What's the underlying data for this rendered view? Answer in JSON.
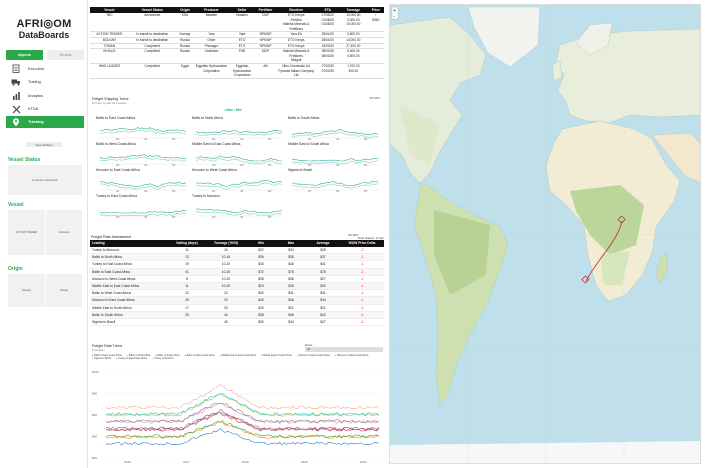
{
  "brand": {
    "name_line1": "AFRI◎OM",
    "name_line2": "DataBoards"
  },
  "tabs": {
    "active": "Imports",
    "inactive": "Exports"
  },
  "menu": [
    {
      "label": "Executive",
      "icon": "clipboard-icon"
    },
    {
      "label": "Trading",
      "icon": "truck-icon"
    },
    {
      "label": "Analytics",
      "icon": "bar-chart-icon"
    },
    {
      "label": "KTDA",
      "icon": "tools-icon"
    },
    {
      "label": "Tracking",
      "icon": "pin-icon"
    }
  ],
  "clear_filters": "Clear all filters",
  "vessel_status": {
    "title": "Vessel Status",
    "card": "in transit to destination"
  },
  "vessel": {
    "title": "Vessel",
    "cards": [
      "ACTION TRADER",
      "Unknown"
    ]
  },
  "origin": {
    "title": "Origin",
    "cards": [
      "Norway",
      "Russia"
    ]
  },
  "vessels_table": {
    "headers": [
      "Vessel",
      "Vessel Status",
      "Origin",
      "Producer",
      "Seller",
      "Fertilizer",
      "Receiver",
      "ETA",
      "Tonnage",
      "Price"
    ],
    "rows": [
      [
        "TBC",
        "Announced",
        "KSA",
        "Maaden",
        "Maaden",
        "DAP",
        "ETG Kenya / Fertiliza / Mabiha Minerals & Fertilizers",
        "07/08/20 / 01/08/20 / 01/08/20",
        "10,000.00 / 3,000.00 / 10,000.00",
        "/ / $360"
      ],
      [
        "ACTION TRADER",
        "In transit to destination",
        "Norway",
        "Yara",
        "Yara",
        "NPK/NP",
        "Yara EA",
        "28/04/20",
        "9,800.00",
        ""
      ],
      [
        "BOLKAR",
        "In transit to destination",
        "Russia",
        "Other",
        "ETG",
        "NPK/NP",
        "ETG Kenya",
        "28/04/20",
        "14,000.00",
        ""
      ],
      [
        "TOMAN",
        "Completed",
        "Russia",
        "Phosagro",
        "ETG",
        "NPK/NP",
        "ETG Kenya",
        "15/03/20",
        "27,400.00",
        ""
      ],
      [
        "IKHALIS",
        "Completed",
        "Russia",
        "Uralchem",
        "FSB",
        "MOP",
        "Mabiha Minerals & Fertilizers / Midgulf",
        "08/03/20 / 08/03/20",
        "9,400.00 / 4,500.00",
        ""
      ],
      [
        "HMO LEADER",
        "Completed",
        "Egypt",
        "Egyptian Hydrocarbon Corporation",
        "Egyptian Hydrocarbon Corporation",
        "AN",
        "Nitro Chemicals Ltd / Pyramid Italian Company Ltd",
        "07/03/20 / 07/03/20",
        "1,970.00 / 300.00",
        ""
      ]
    ]
  },
  "shipping_trend": {
    "title": "Freight Shipping Trend",
    "subtitle": "by Freq / by past from location",
    "legend": "• Max  • Min",
    "badge": "ZIP EDIT",
    "panels": [
      "Baltic to East Coast Africa",
      "Baltic to North Africa",
      "Baltic to South Africa",
      "Baltic to West Coast Africa",
      "Middle East to East Coast Africa",
      "Middle East to South Africa",
      "Morocco to East Coast Africa",
      "Morocco to West Coast Africa",
      "Nigeria to Brazil",
      "Turkey to East Coast Africa",
      "Turkey to Morocco"
    ],
    "ticks": [
      "20",
      "40",
      "60"
    ]
  },
  "rate_assessment": {
    "title": "Freight Rate Assessment",
    "badge": "ZIP EDIT",
    "timestamp": "Time Stamp: 17 Apr 20",
    "headers": [
      "Leading",
      "Sailing (days)",
      "Tonnage ('000t)",
      "Min",
      "Max",
      "Average",
      "WOW Price Delta"
    ],
    "rows": [
      [
        "Turkey to Morocco",
        "11",
        "10",
        "$22",
        "$34",
        "$28",
        "-2"
      ],
      [
        "Baltic to North Africa",
        "13",
        "10-16",
        "$36",
        "$38",
        "$37",
        "-1"
      ],
      [
        "Turkey to East Coast Africa",
        "19",
        "10-20",
        "$33",
        "$48",
        "$41",
        "-1"
      ],
      [
        "Baltic to East Coast Africa",
        "41",
        "10-20",
        "$72",
        "$78",
        "$75",
        "-2"
      ],
      [
        "Morocco to West Coast Africa",
        "8",
        "10-20",
        "$28",
        "$38",
        "$27",
        "-1"
      ],
      [
        "Middle East to East Coast Africa",
        "11",
        "10-20",
        "$24",
        "$35",
        "$30",
        "-1"
      ],
      [
        "Baltic to West Coast Africa",
        "20",
        "20",
        "$40",
        "$41",
        "$41",
        "-1"
      ],
      [
        "Morocco to East Coast Africa",
        "25",
        "20",
        "$40",
        "$48",
        "$44",
        "-1"
      ],
      [
        "Middle East to South Africa",
        "17",
        "20",
        "$20",
        "$22",
        "$21",
        "-1"
      ],
      [
        "Baltic to South Africa",
        "25",
        "40",
        "$38",
        "$46",
        "$42",
        "-1"
      ],
      [
        "Nigeria to Brazil",
        "",
        "40",
        "$20",
        "$34",
        "$27",
        "-1"
      ]
    ]
  },
  "rate_trend": {
    "title": "Freight Rate Trend",
    "subtitle": "by location",
    "filter_label": "Route",
    "filter_value": "All",
    "legend": [
      "Baltic to East Coast Africa",
      "Baltic to North Africa",
      "Baltic to South Africa",
      "Baltic to West Coast Africa",
      "Middle East to East Coast Africa",
      "Middle East to South Africa",
      "Morocco to East Coast Africa",
      "Morocco to West Coast Africa",
      "Nigeria to Brazil",
      "Turkey to East Coast Africa",
      "Turkey to Morocco"
    ],
    "yticks": [
      "$100",
      "$80",
      "$60",
      "$40",
      "$20"
    ],
    "xticks": [
      "2016",
      "2017",
      "2018",
      "2019",
      "2020"
    ]
  },
  "colors": {
    "accent": "#2aa84a",
    "line": "#34a99d",
    "route": "#b04040"
  }
}
